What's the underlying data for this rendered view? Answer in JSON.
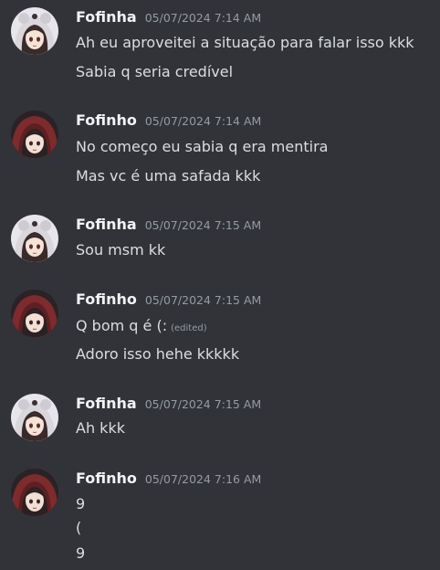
{
  "colors": {
    "background": "#313338",
    "username": "#f2f3f5",
    "timestamp": "#949ba4",
    "message_text": "#dbdee1"
  },
  "messages": [
    {
      "username": "Fofinha",
      "timestamp": "05/07/2024 7:14 AM",
      "avatar_icon": "fofinha-avatar-icon",
      "lines": [
        "Ah eu aproveitei a situação para falar isso kkk",
        "Sabia q seria credível"
      ]
    },
    {
      "username": "Fofinho",
      "timestamp": "05/07/2024 7:14 AM",
      "avatar_icon": "fofinho-avatar-icon",
      "lines": [
        "No começo eu sabia q era mentira",
        "Mas vc é uma safada kkk"
      ]
    },
    {
      "username": "Fofinha",
      "timestamp": "05/07/2024 7:15 AM",
      "avatar_icon": "fofinha-avatar-icon",
      "lines": [
        "Sou msm kk"
      ]
    },
    {
      "username": "Fofinho",
      "timestamp": "05/07/2024 7:15 AM",
      "avatar_icon": "fofinho-avatar-icon",
      "lines": [
        "Q bom q é (:",
        "Adoro isso hehe kkkkk"
      ],
      "edited_label": "(edited)"
    },
    {
      "username": "Fofinha",
      "timestamp": "05/07/2024 7:15 AM",
      "avatar_icon": "fofinha-avatar-icon",
      "lines": [
        "Ah kkk"
      ]
    },
    {
      "username": "Fofinho",
      "timestamp": "05/07/2024 7:16 AM",
      "avatar_icon": "fofinho-avatar-icon",
      "lines": [
        "9",
        "(",
        "9"
      ]
    }
  ]
}
